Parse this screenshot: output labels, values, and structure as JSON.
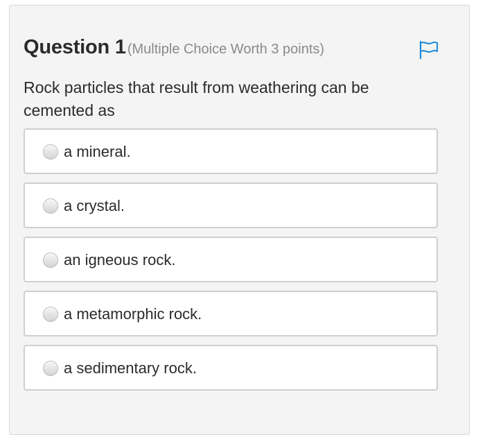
{
  "question": {
    "title": "Question 1",
    "meta": "(Multiple Choice Worth 3 points)",
    "prompt": "Rock particles that result from weathering can be cemented as",
    "flag_icon": "flag-icon"
  },
  "options": [
    {
      "label": "a mineral.",
      "selected": false
    },
    {
      "label": "a crystal.",
      "selected": false
    },
    {
      "label": "an igneous rock.",
      "selected": false
    },
    {
      "label": "a metamorphic rock.",
      "selected": false
    },
    {
      "label": "a sedimentary rock.",
      "selected": false
    }
  ],
  "colors": {
    "accent": "#1a8ad8",
    "card_bg": "#f4f4f4",
    "text": "#2b2b2b",
    "meta_text": "#8a8a8a",
    "option_border": "#cfcfcf"
  }
}
